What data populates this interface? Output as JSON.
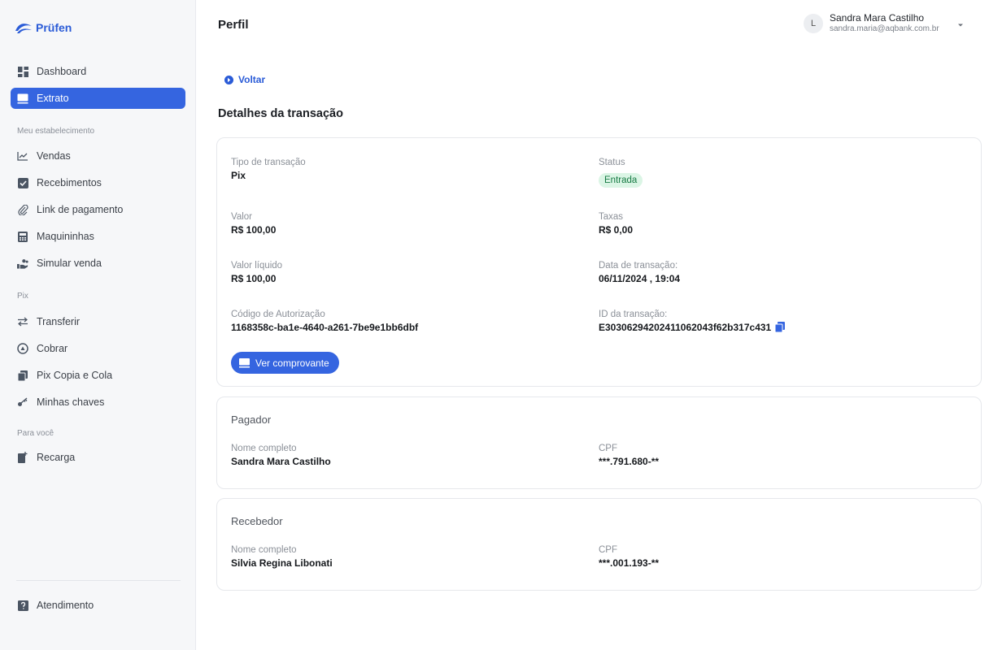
{
  "brand": {
    "name": "Prüfen",
    "accent": "#3565e0"
  },
  "sidebar": {
    "items": [
      {
        "label": "Dashboard",
        "icon": "dashboard-icon"
      },
      {
        "label": "Extrato",
        "icon": "receipt-icon",
        "active": true
      }
    ],
    "section_estabelecimento": "Meu estabelecimento",
    "estabelecimento_items": [
      {
        "label": "Vendas",
        "icon": "chart-line-icon"
      },
      {
        "label": "Recebimentos",
        "icon": "checkbox-icon"
      },
      {
        "label": "Link de pagamento",
        "icon": "paperclip-icon"
      },
      {
        "label": "Maquininhas",
        "icon": "card-machine-icon"
      },
      {
        "label": "Simular venda",
        "icon": "hand-coins-icon"
      }
    ],
    "section_pix": "Pix",
    "pix_items": [
      {
        "label": "Transferir",
        "icon": "transfer-arrows-icon"
      },
      {
        "label": "Cobrar",
        "icon": "coin-icon"
      },
      {
        "label": "Pix Copia e Cola",
        "icon": "copy-icon"
      },
      {
        "label": "Minhas chaves",
        "icon": "key-icon"
      }
    ],
    "section_voce": "Para você",
    "voce_items": [
      {
        "label": "Recarga",
        "icon": "phone-plus-icon"
      }
    ],
    "footer_item": {
      "label": "Atendimento",
      "icon": "help-icon"
    }
  },
  "header": {
    "title": "Perfil",
    "user_initial": "L",
    "user_name": "Sandra Mara Castilho",
    "user_email": "sandra.maria@aqbank.com.br"
  },
  "back_label": "Voltar",
  "section_title": "Detalhes da transação",
  "transaction": {
    "tipo_label": "Tipo de transação",
    "tipo_value": "Pix",
    "status_label": "Status",
    "status_value": "Entrada",
    "valor_label": "Valor",
    "valor_value": "R$ 100,00",
    "taxas_label": "Taxas",
    "taxas_value": "R$ 0,00",
    "liquido_label": "Valor líquido",
    "liquido_value": "R$ 100,00",
    "data_label": "Data de transação:",
    "data_value": "06/11/2024 , 19:04",
    "codigo_label": "Código de Autorização",
    "codigo_value": "1168358c-ba1e-4640-a261-7be9e1bb6dbf",
    "id_label": "ID da transação:",
    "id_value": "E30306294202411062043f62b317c431",
    "receipt_button": "Ver comprovante"
  },
  "pagador": {
    "title": "Pagador",
    "nome_label": "Nome completo",
    "nome_value": "Sandra Mara Castilho",
    "cpf_label": "CPF",
    "cpf_value": "***.791.680-**"
  },
  "recebedor": {
    "title": "Recebedor",
    "nome_label": "Nome completo",
    "nome_value": "Silvia Regina Libonati",
    "cpf_label": "CPF",
    "cpf_value": "***.001.193-**"
  }
}
